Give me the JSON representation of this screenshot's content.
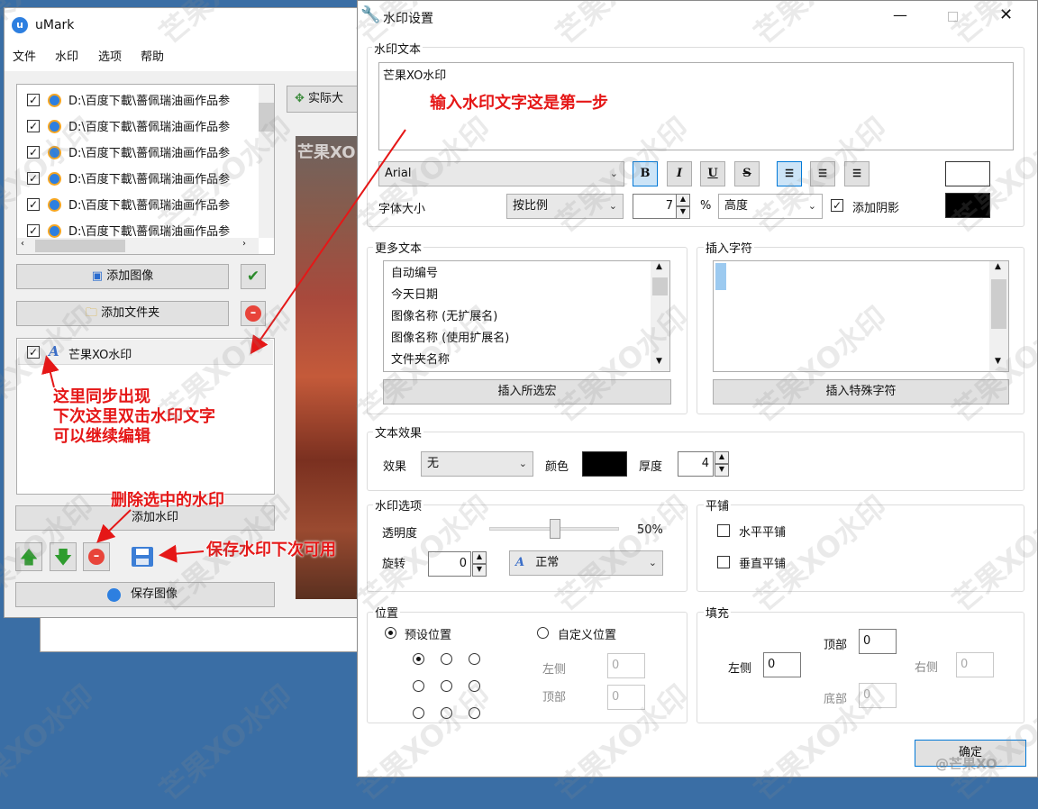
{
  "main_window": {
    "title": "uMark",
    "menu": [
      "文件",
      "水印",
      "选项",
      "帮助"
    ],
    "files": [
      "D:\\百度下載\\薔佩瑞油画作品参",
      "D:\\百度下載\\薔佩瑞油画作品参",
      "D:\\百度下載\\薔佩瑞油画作品参",
      "D:\\百度下載\\薔佩瑞油画作品参",
      "D:\\百度下載\\薔佩瑞油画作品参",
      "D:\\百度下載\\薔佩瑞油画作品参"
    ],
    "add_image": "添加图像",
    "add_folder": "添加文件夹",
    "actual_size": "实际大",
    "preview_text": "芒果XO",
    "watermark_item": "芒果XO水印",
    "add_watermark": "添加水印",
    "save_image": "保存图像"
  },
  "dialog": {
    "title": "水印设置",
    "watermark_text_group": "水印文本",
    "watermark_text": "芒果XO水印",
    "font": "Arial",
    "format_buttons": [
      "B",
      "I",
      "U",
      "S"
    ],
    "align_active": 0,
    "font_size_label": "字体大小",
    "size_mode": "按比例",
    "size_value": "7",
    "percent": "%",
    "size_basis": "高度",
    "shadow_label": "添加阴影",
    "colors": {
      "font": "#ffffff",
      "shadow": "#000000",
      "effect": "#000000"
    },
    "more_text_group": "更多文本",
    "more_text_items": [
      "自动编号",
      "今天日期",
      "图像名称 (无扩展名)",
      "图像名称 (使用扩展名)",
      "文件夹名称"
    ],
    "insert_macro": "插入所选宏",
    "insert_char_group": "插入字符",
    "insert_special": "插入特殊字符",
    "effects_group": "文本效果",
    "effect_label": "效果",
    "effect_value": "无",
    "color_label": "颜色",
    "thickness_label": "厚度",
    "thickness_value": "4",
    "options_group": "水印选项",
    "opacity_label": "透明度",
    "opacity_value": "50%",
    "opacity_fraction": 0.5,
    "rotate_label": "旋转",
    "rotate_value": "0",
    "rotate_mode": "正常",
    "tile_group": "平铺",
    "tile_h": "水平平铺",
    "tile_v": "垂直平铺",
    "position_group": "位置",
    "preset_pos": "预设位置",
    "custom_pos": "自定义位置",
    "left_label": "左侧",
    "top_label": "顶部",
    "custom_left": "0",
    "custom_top": "0",
    "fill_group": "填充",
    "fill_top_label": "顶部",
    "fill_left_label": "左侧",
    "fill_right_label": "右侧",
    "fill_bottom_label": "底部",
    "fill_top": "0",
    "fill_left": "0",
    "fill_right": "0",
    "fill_bottom": "0",
    "ok": "确定"
  },
  "annotations": {
    "step1": "输入水印文字这是第一步",
    "sync_1": "这里同步出现",
    "sync_2": "下次这里双击水印文字",
    "sync_3": "可以继续编辑",
    "delete": "删除选中的水印",
    "save": "保存水印下次可用"
  },
  "watermark": "芒果XO水印",
  "watermark_corner": "@芒果XO"
}
